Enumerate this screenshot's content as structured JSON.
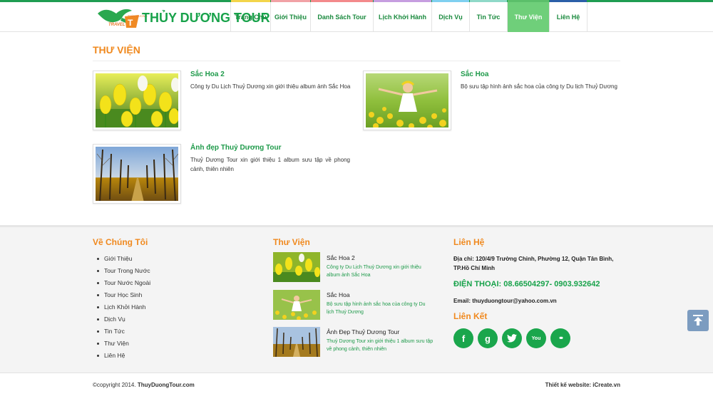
{
  "brand": {
    "name": "THỦY DƯƠNG TOUR",
    "travel": "TRAVEL",
    "tag": "THỦY DƯƠNG"
  },
  "nav": [
    {
      "label": "Trang Chủ",
      "color": "#f3d54a"
    },
    {
      "label": "Giới Thiệu",
      "color": "#f1a2a6"
    },
    {
      "label": "Danh Sách Tour",
      "color": "#f3898b"
    },
    {
      "label": "Lịch Khởi Hành",
      "color": "#c69ee0"
    },
    {
      "label": "Dịch Vụ",
      "color": "#7fd0f0"
    },
    {
      "label": "Tin Tức",
      "color": "#8fd9c8"
    },
    {
      "label": "Thư Viện",
      "color": "#5bbf6a"
    },
    {
      "label": "Liên Hệ",
      "color": "#2b5fa8"
    }
  ],
  "active_nav": "Thư Viện",
  "page_title": "THƯ VIỆN",
  "albums": [
    {
      "title": "Sắc Hoa 2",
      "desc": "Công ty Du Lịch Thuỷ Dương xin giới thiệu album ảnh Sắc Hoa",
      "image": "yellow-tulips"
    },
    {
      "title": "Sắc Hoa",
      "desc": "Bộ sưu tập hình ảnh sắc hoa của công ty Du lịch Thuỷ Dương",
      "image": "girl-in-flower-field"
    },
    {
      "title": "Ảnh đẹp Thuỷ Dương Tour",
      "desc": "Thuỷ Dương Tour xin giới thiệu 1 album sưu tập về phong cảnh, thiên nhiên",
      "image": "autumn-tree-avenue"
    }
  ],
  "footer": {
    "about_heading": "Về Chúng Tôi",
    "about_links": [
      "Giới Thiệu",
      "Tour Trong Nước",
      "Tour Nước Ngoài",
      "Tour Học Sinh",
      "Lịch Khởi Hành",
      "Dịch Vụ",
      "Tin Tức",
      "Thư Viện",
      "Liên Hệ"
    ],
    "gallery_heading": "Thư Viện",
    "gallery": [
      {
        "title": "Sắc Hoa 2",
        "desc": "Công ty Du Lịch Thuỷ Dương xin giới thiệu album ảnh Sắc Hoa"
      },
      {
        "title": "Sắc Hoa",
        "desc": "Bộ sưu tập hình ảnh sắc hoa của công ty Du lịch Thuỷ Dương"
      },
      {
        "title": "Ảnh Đẹp Thuỷ Dương Tour",
        "desc": "Thuỷ Dương Tour xin giới thiệu 1 album sưu tập về phong cảnh, thiên nhiên"
      }
    ],
    "contact_heading": "Liên Hệ",
    "address": "Địa chỉ: 120/4/9 Trường Chinh, Phường 12, Quận Tân Bình, TP.Hồ Chí Minh",
    "phone": "ĐIỆN THOẠI: 08.66504297- 0903.932642",
    "email": "Email: thuyduongtour@yahoo.com.vn",
    "links_heading": "Liên Kết",
    "social": [
      {
        "name": "facebook-icon",
        "glyph": "f"
      },
      {
        "name": "google-plus-icon",
        "glyph": "g"
      },
      {
        "name": "twitter-icon",
        "glyph": "t"
      },
      {
        "name": "youtube-icon",
        "glyph": "You"
      },
      {
        "name": "flickr-icon",
        "glyph": "••"
      }
    ]
  },
  "copyright_prefix": "©copyright 2014.",
  "copyright_site": "ThuyDuongTour.com",
  "designer": "Thiết kế website: iCreate.vn",
  "colors": {
    "green": "#1e9a4a",
    "orange": "#f0891e",
    "active_nav": "#6fcf7a"
  }
}
